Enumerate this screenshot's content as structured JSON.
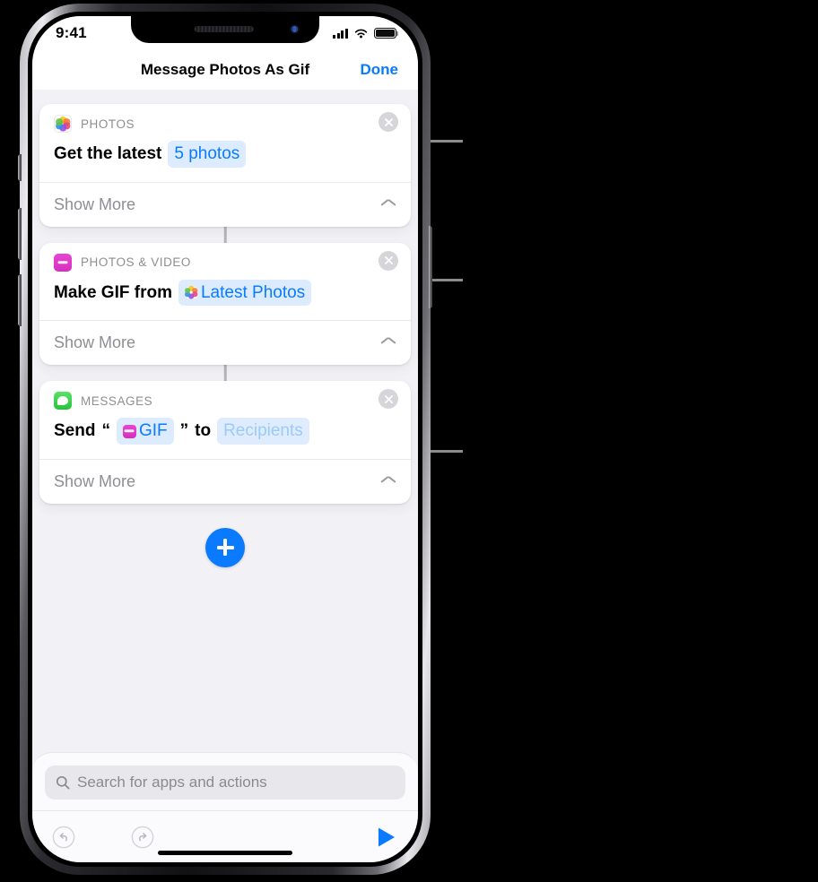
{
  "status_bar": {
    "time": "9:41",
    "cellular_icon": "cellular-bars-icon",
    "wifi_icon": "wifi-icon",
    "battery_icon": "battery-full-icon"
  },
  "nav": {
    "title": "Message Photos As Gif",
    "done_label": "Done"
  },
  "actions": [
    {
      "category": "PHOTOS",
      "app_icon": "photos-app-icon",
      "prefix": "Get the latest",
      "token": {
        "label": "5 photos",
        "icon": null,
        "placeholder": false
      },
      "suffix": "",
      "footer_label": "Show More",
      "chevron_icon": "chevron-up-icon",
      "close_icon": "close-circle-icon"
    },
    {
      "category": "PHOTOS & VIDEO",
      "app_icon": "media-app-icon",
      "prefix": "Make GIF from",
      "token": {
        "label": "Latest Photos",
        "icon": "photos-app-icon",
        "placeholder": false
      },
      "suffix": "",
      "footer_label": "Show More",
      "chevron_icon": "chevron-up-icon",
      "close_icon": "close-circle-icon"
    },
    {
      "category": "MESSAGES",
      "app_icon": "messages-app-icon",
      "prefix": "Send",
      "open_quote": "“",
      "token": {
        "label": "GIF",
        "icon": "media-app-icon",
        "placeholder": false
      },
      "close_quote": "”",
      "mid": "to",
      "token2": {
        "label": "Recipients",
        "icon": null,
        "placeholder": true
      },
      "footer_label": "Show More",
      "chevron_icon": "chevron-up-icon",
      "close_icon": "close-circle-icon"
    }
  ],
  "add_button": {
    "icon": "plus-icon"
  },
  "search": {
    "placeholder": "Search for apps and actions",
    "icon": "search-icon"
  },
  "toolbar": {
    "undo_icon": "undo-icon",
    "redo_icon": "redo-icon",
    "run_icon": "play-icon"
  },
  "colors": {
    "accent": "#0a7bff",
    "token_bg": "#dcebfd",
    "placeholder_text": "#9ccbf7",
    "background": "#f2f2f6"
  }
}
